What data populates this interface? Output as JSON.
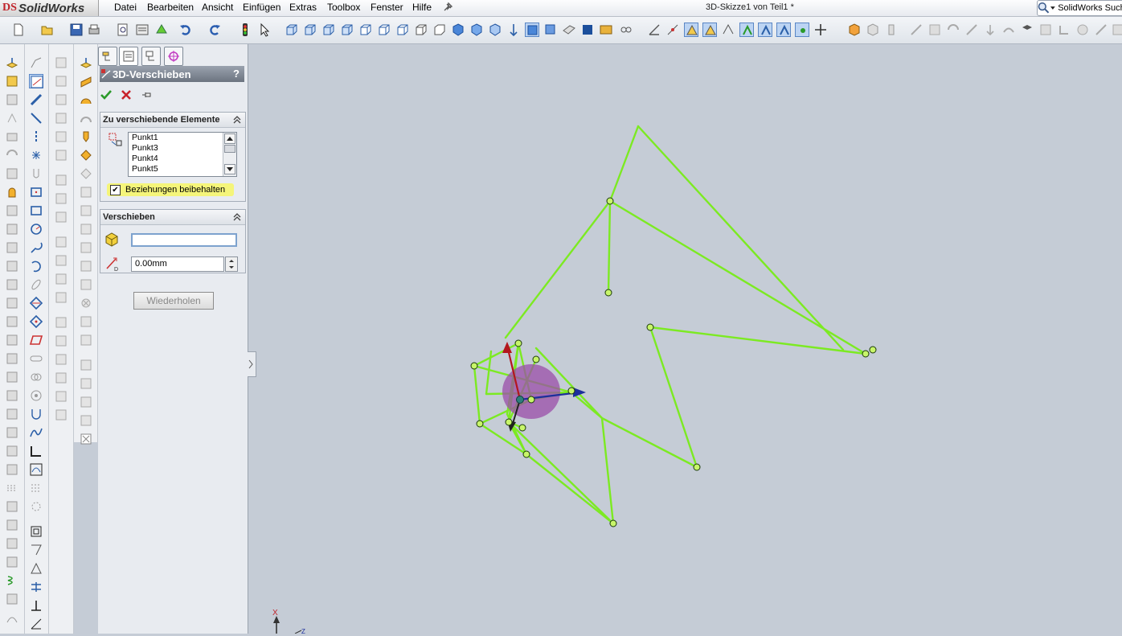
{
  "app": {
    "name": "SolidWorks",
    "logo_glyph": "DS"
  },
  "menu": {
    "items": [
      "Datei",
      "Bearbeiten",
      "Ansicht",
      "Einfügen",
      "Extras",
      "Toolbox",
      "Fenster",
      "Hilfe"
    ]
  },
  "window": {
    "title": "3D-Skizze1 von Teil1 *"
  },
  "search": {
    "placeholder": "SolidWorks Such"
  },
  "property_manager": {
    "title": "3D-Verschieben",
    "help": "?",
    "group_elements": {
      "title": "Zu verschiebende Elemente",
      "items": [
        "Punkt1",
        "Punkt3",
        "Punkt4",
        "Punkt5"
      ],
      "keep_relations_label": "Beziehungen beibehalten",
      "keep_relations_checked": true
    },
    "group_move": {
      "title": "Verschieben",
      "coordinate_value": "",
      "distance_value": "0.00mm"
    },
    "repeat_label": "Wiederholen"
  },
  "triad": {
    "x_label": "X",
    "z_label": "Z"
  },
  "colors": {
    "sketch": "#7cea22",
    "accent_highlight": "#f5f57a",
    "selected_region": "#9a4ea8"
  },
  "icons": {
    "toolbar": [
      "new-file-icon",
      "open-icon",
      "save-icon",
      "print-icon",
      "print-preview-icon",
      "options-icon",
      "rebuild-icon",
      "undo-icon",
      "redo-icon",
      "traffic-light-icon",
      "select-icon",
      "cube-view-icons",
      "zoom-icon",
      "rotate-icon",
      "sketch-tools-icons",
      "display-style-icons"
    ],
    "property_tabs": [
      "feature-manager-icon",
      "property-manager-icon",
      "configuration-manager-icon",
      "dim-xpert-icon"
    ]
  }
}
